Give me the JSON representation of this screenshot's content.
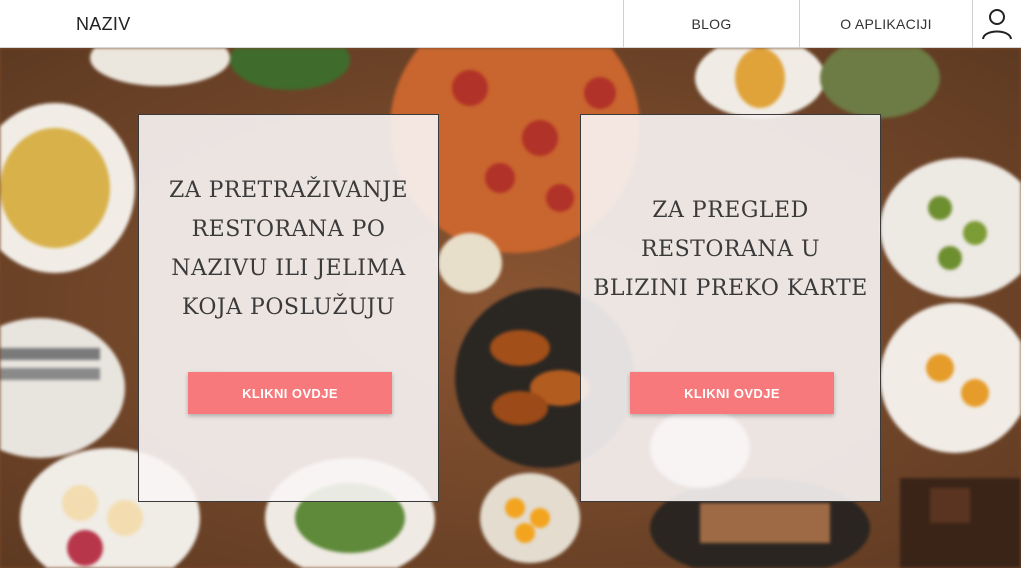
{
  "header": {
    "brand": "NAZIV",
    "nav": {
      "blog": "BLOG",
      "about": "O APLIKACIJI"
    },
    "user_icon": "user-icon"
  },
  "cards": [
    {
      "text": "ZA PRETRAŽIVANJE RESTORANA PO NAZIVU ILI JELIMA KOJA POSLUŽUJU",
      "button": "KLIKNI OVDJE"
    },
    {
      "text": "ZA PREGLED RESTORANA U BLIZINI PREKO KARTE",
      "button": "KLIKNI OVDJE"
    }
  ],
  "colors": {
    "accent": "#f7797b",
    "header_bg": "#ffffff",
    "card_bg": "#f8f5f5"
  }
}
